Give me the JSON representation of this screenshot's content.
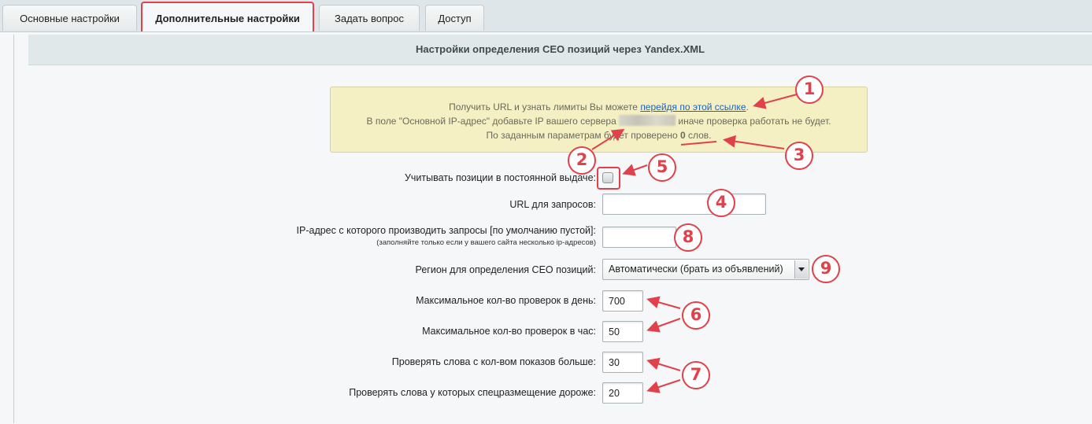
{
  "tabs": [
    {
      "label": "Основные настройки",
      "active": false
    },
    {
      "label": "Дополнительные настройки",
      "active": true
    },
    {
      "label": "Задать вопрос",
      "active": false
    },
    {
      "label": "Доступ",
      "active": false
    }
  ],
  "section": {
    "title": "Настройки определения СЕО позиций через Yandex.XML"
  },
  "notice": {
    "line1_text": "Получить URL и узнать лимиты Вы можете ",
    "line1_link": "перейдя по этой ссылке",
    "line1_end": ".",
    "line2_before": "В поле \"Основной IP-адрес\" добавьте IP вашего сервера ",
    "line2_after": " иначе проверка работать не будет.",
    "line3_before": "По заданным параметрам будет проверено ",
    "line3_count": "0",
    "line3_after": " слов."
  },
  "form": {
    "permanent_label": "Учитывать позиции в постоянной выдаче:",
    "permanent_checked": false,
    "url_label": "URL для запросов:",
    "url_value": "",
    "ip_label": "IP-адрес с которого производить запросы [по умолчанию пустой]:",
    "ip_sublabel": "(заполняйте только если у вашего сайта несколько ip-адресов)",
    "ip_value": "",
    "region_label": "Регион для определения СЕО позиций:",
    "region_value": "Автоматически (брать из объявлений)",
    "per_day_label": "Максимальное кол-во проверок в день:",
    "per_day_value": "700",
    "per_hour_label": "Максимальное кол-во проверок в час:",
    "per_hour_value": "50",
    "impressions_label": "Проверять слова с кол-вом показов больше:",
    "impressions_value": "30",
    "cost_label": "Проверять слова у которых спецразмещение дороже:",
    "cost_value": "20"
  },
  "annotations": [
    "1",
    "2",
    "3",
    "4",
    "5",
    "6",
    "7",
    "8",
    "9"
  ],
  "colors": {
    "accent": "#e0414a",
    "notice_bg": "#f5f0c3",
    "link": "#1c64b8"
  }
}
